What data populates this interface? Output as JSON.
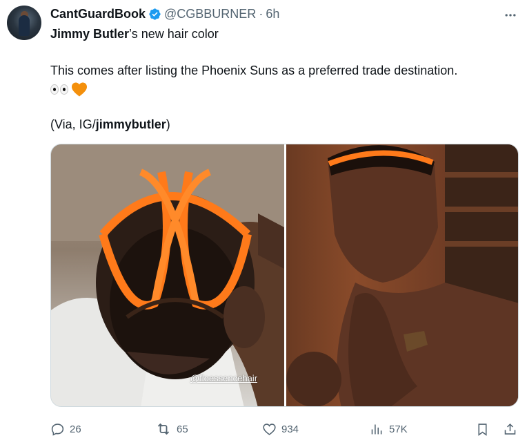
{
  "author": {
    "name": "CantGuardBook",
    "handle": "@CGBBURNER",
    "separator": "·",
    "time": "6h"
  },
  "tweet": {
    "line1_bold": "Jimmy Butler",
    "line1_rest": "’s new hair color",
    "line2": "This comes after listing the Phoenix Suns as a preferred trade destination.",
    "line3_prefix": "(Via, IG/",
    "line3_bold": "jimmybutler",
    "line3_suffix": ")",
    "emojis": [
      "eyes-emoji",
      "orange-heart-emoji"
    ]
  },
  "media": {
    "watermark": "@floessencehair"
  },
  "actions": {
    "replies": "26",
    "reposts": "65",
    "likes": "934",
    "views": "57K"
  },
  "colors": {
    "verified": "#1d9bf0",
    "secondary_text": "#536471",
    "orange_braids": "#ff7a1a"
  }
}
